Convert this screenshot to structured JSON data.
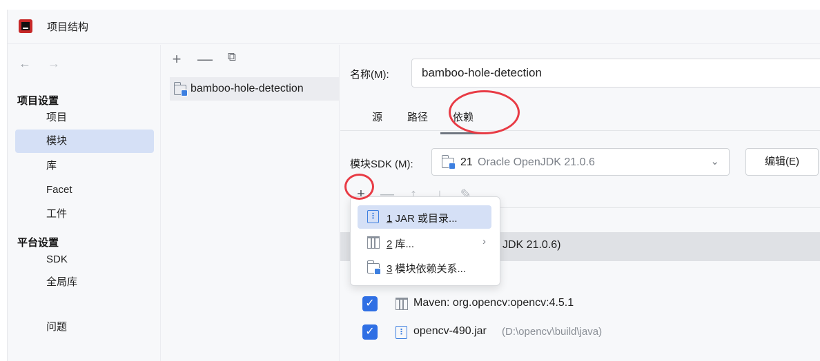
{
  "window": {
    "title": "项目结构"
  },
  "sidebar": {
    "back": "←",
    "forward": "→",
    "project_settings_heading": "项目设置",
    "items": [
      {
        "label": "项目"
      },
      {
        "label": "模块",
        "selected": true
      },
      {
        "label": "库"
      },
      {
        "label": "Facet"
      },
      {
        "label": "工件"
      }
    ],
    "platform_settings_heading": "平台设置",
    "platform_items": [
      {
        "label": "SDK"
      },
      {
        "label": "全局库"
      }
    ],
    "problems": "问题"
  },
  "modules_panel": {
    "toolbar": {
      "add": "+",
      "remove": "—",
      "copy": "⧉"
    },
    "modules": [
      {
        "label": "bamboo-hole-detection"
      }
    ]
  },
  "content": {
    "name_label": "名称(M):",
    "name_value": "bamboo-hole-detection",
    "tabs": [
      {
        "label": "源"
      },
      {
        "label": "路径"
      },
      {
        "label": "依赖",
        "active": true
      }
    ],
    "sdk_label": "模块SDK (M):",
    "sdk_version": "21",
    "sdk_description": "Oracle OpenJDK 21.0.6",
    "edit_button": "编辑(E)",
    "dep_toolbar": {
      "add": "+",
      "remove": "—",
      "up": "↑",
      "down": "↓",
      "edit": "✎"
    },
    "dependencies": [
      {
        "label": "JDK 21.0.6)",
        "highlighted": true
      },
      {
        "label": "Maven: org.opencv:opencv:4.5.1",
        "checked": true,
        "icon": "library-icon"
      },
      {
        "label": "opencv-490.jar",
        "path": "(D:\\opencv\\build\\java)",
        "checked": true,
        "icon": "jar-icon"
      }
    ]
  },
  "add_popup": {
    "items": [
      {
        "number": "1",
        "label": "JAR 或目录...",
        "icon": "jar-icon",
        "selected": true
      },
      {
        "number": "2",
        "label": "库...",
        "icon": "library-icon",
        "submenu": "›"
      },
      {
        "number": "3",
        "label": "模块依赖关系...",
        "icon": "module-folder-icon"
      }
    ]
  },
  "colors": {
    "accent": "#2f6fe4",
    "selection": "#d5e0f6",
    "annotation": "#e83b45"
  }
}
